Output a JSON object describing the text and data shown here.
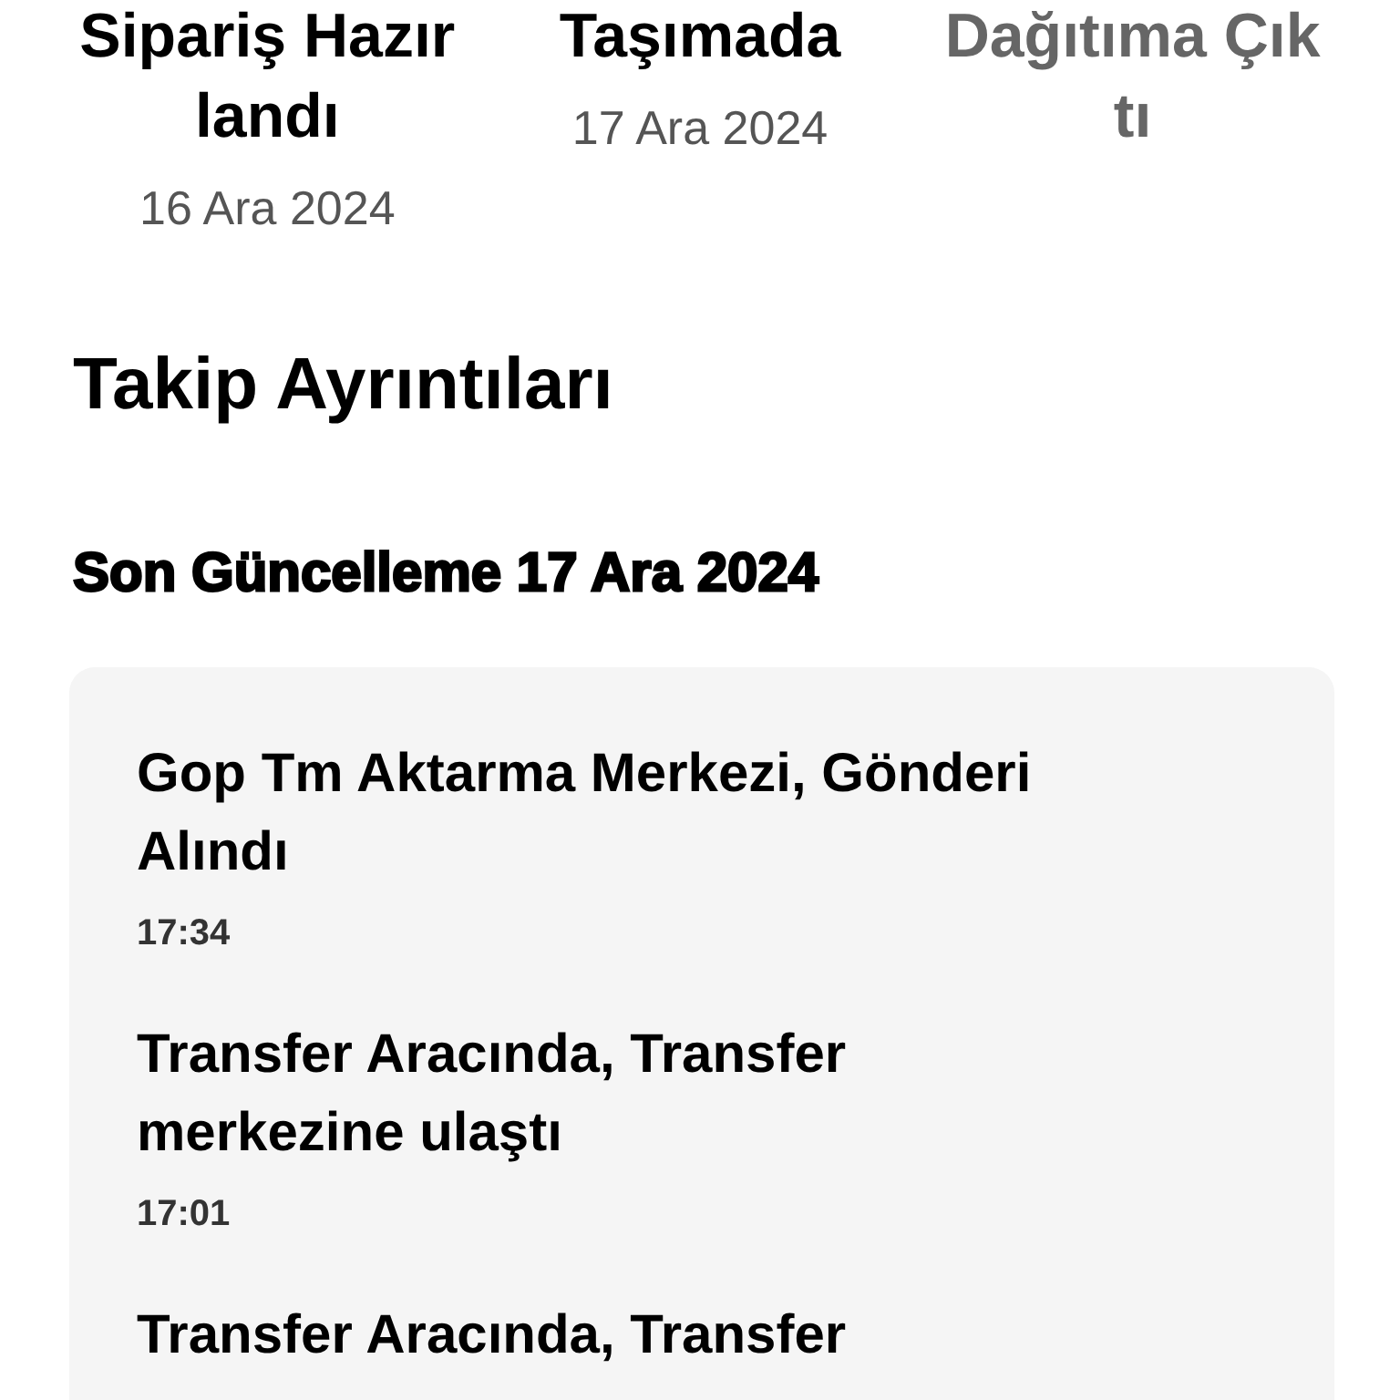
{
  "steps": [
    {
      "title": "Sipariş Hazırlandı",
      "date": "16 Ara 2024",
      "done": true
    },
    {
      "title": "Taşımada",
      "date": "17 Ara 2024",
      "done": true
    },
    {
      "title": "Dağıtıma Çıktı",
      "done": false
    }
  ],
  "tracking": {
    "heading": "Takip Ayrıntıları",
    "last_update": "Son Güncelleme 17 Ara 2024",
    "events": [
      {
        "title": "Gop Tm Aktarma Merkezi, Gönderi Alındı",
        "time": "17:34"
      },
      {
        "title": "Transfer Aracında, Transfer merkezine ulaştı",
        "time": "17:01"
      },
      {
        "title": "Transfer Aracında, Transfer"
      }
    ]
  }
}
